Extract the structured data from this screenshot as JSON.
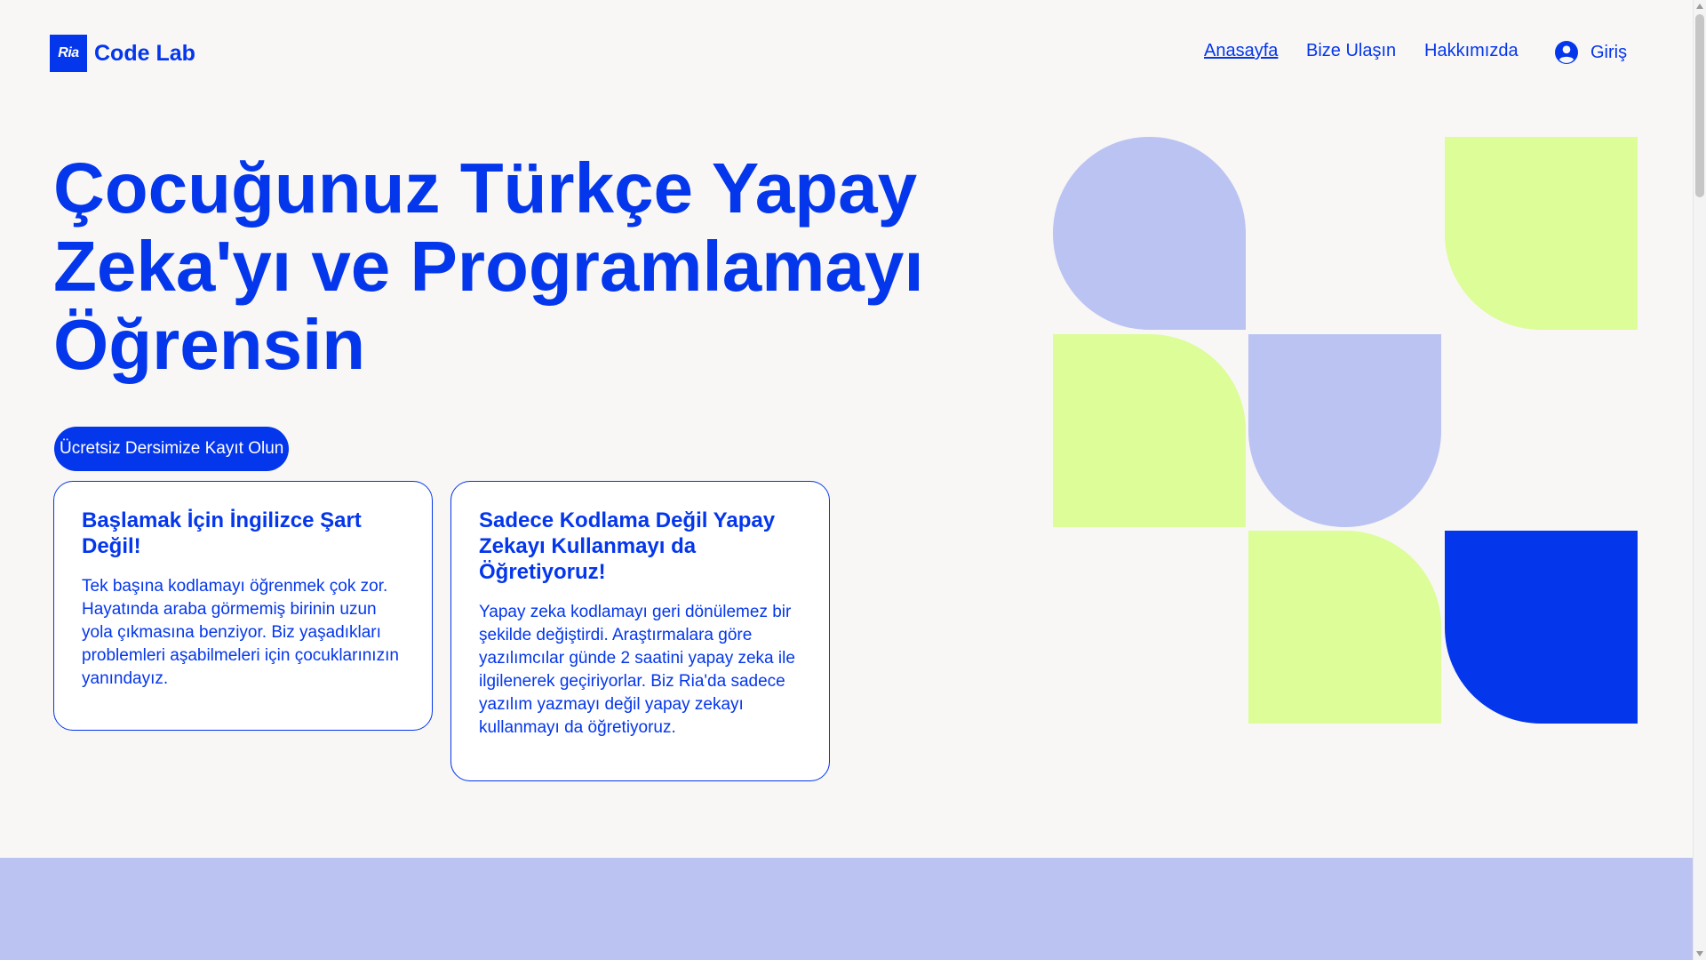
{
  "brand": {
    "logo_text": "Ria",
    "name": "Code Lab",
    "color": "#0436ec"
  },
  "nav": {
    "home": "Anasayfa",
    "contact": "Bize Ulaşın",
    "about": "Hakkımızda",
    "login": "Giriş"
  },
  "hero": {
    "title": "Çocuğunuz Türkçe Yapay Zeka'yı ve Programlamayı Öğrensin",
    "cta": "Ücretsiz Dersimize Kayıt Olun"
  },
  "cards": [
    {
      "title": "Başlamak İçin İngilizce Şart Değil!",
      "text": "Tek başına kodlamayı öğrenmek çok zor. Hayatında araba görmemiş birinin uzun yola çıkmasına benziyor. Biz yaşadıkları problemleri aşabilmeleri için çocuklarınızın yanındayız."
    },
    {
      "title": "Sadece Kodlama Değil Yapay Zekayı Kullanmayı da Öğretiyoruz!",
      "text": "Yapay zeka kodlamayı geri dönülemez bir şekilde değiştirdi. Araştırmalara göre yazılımcılar günde 2 saatini yapay zeka ile ilgilenerek geçiriyorlar. Biz Ria'da sadece yazılım yazmayı değil yapay zekayı kullanmayı da öğretiyoruz."
    }
  ],
  "colors": {
    "primary": "#0436ec",
    "lavender": "#bbc3f2",
    "lime": "#dcfd98",
    "background": "#f8f7f5"
  },
  "icons": {
    "login": "user-circle-icon"
  }
}
